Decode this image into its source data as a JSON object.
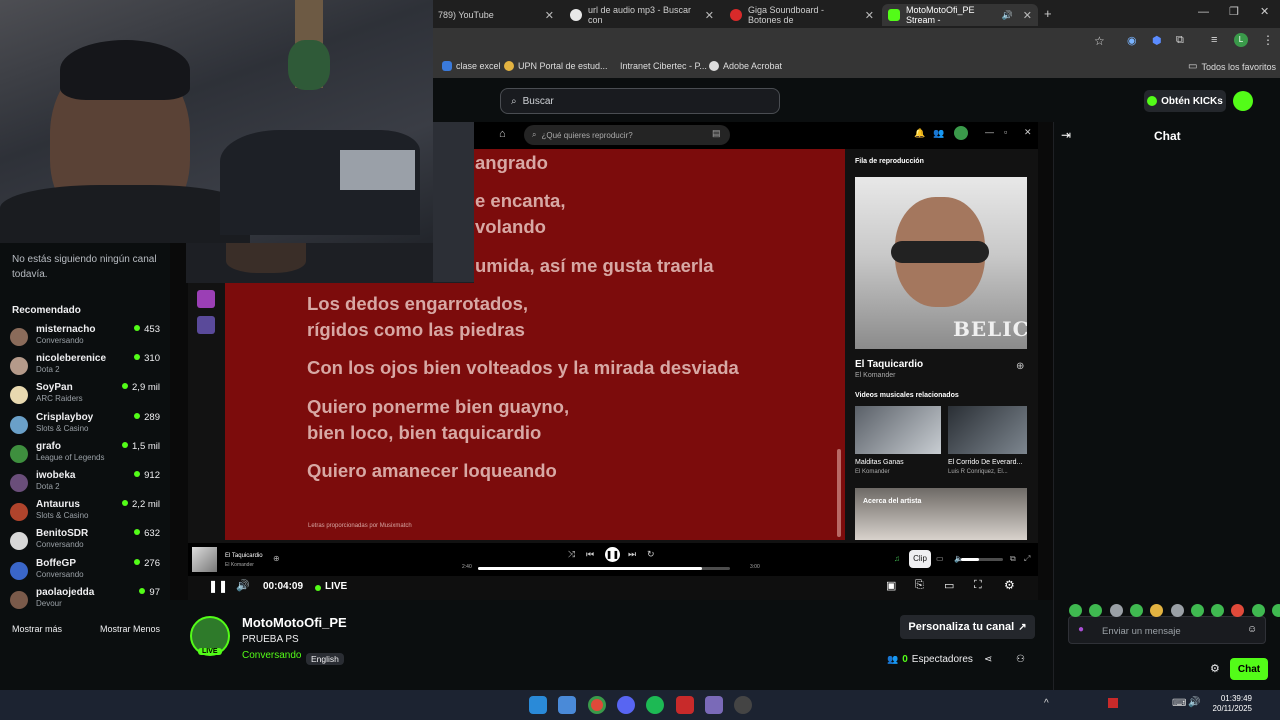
{
  "browser": {
    "tabs": [
      {
        "label": "789) YouTube"
      },
      {
        "label": "url de audio mp3 - Buscar con"
      },
      {
        "label": "Giga Soundboard - Botones de"
      },
      {
        "label": "MotoMotoOfi_PE Stream -"
      }
    ],
    "bookmarks": [
      "clase excel",
      "UPN Portal de estud...",
      "Intranet Cibertec - P...",
      "Adobe Acrobat"
    ],
    "all_bookmarks": "Todos los favoritos",
    "profile_letter": "L"
  },
  "kick": {
    "search_placeholder": "Buscar",
    "get_kicks": "Obtén KICKs"
  },
  "sidebar": {
    "following_empty": "No estás siguiendo ningún canal todavía.",
    "recommended_title": "Recomendado",
    "items": [
      {
        "name": "misternacho",
        "game": "Conversando",
        "count": "453",
        "color": "#8a6b5a"
      },
      {
        "name": "nicoleberenice",
        "game": "Dota 2",
        "count": "310",
        "color": "#b59a8a"
      },
      {
        "name": "SoyPan",
        "game": "ARC Raiders",
        "count": "2,9 mil",
        "color": "#e8d9b0"
      },
      {
        "name": "Crisplayboy",
        "game": "Slots & Casino",
        "count": "289",
        "color": "#6aa0c8"
      },
      {
        "name": "grafo",
        "game": "League of Legends",
        "count": "1,5 mil",
        "color": "#3e8f3e"
      },
      {
        "name": "iwobeka",
        "game": "Dota 2",
        "count": "912",
        "color": "#6a4e7a"
      },
      {
        "name": "Antaurus",
        "game": "Slots & Casino",
        "count": "2,2 mil",
        "color": "#b0442c"
      },
      {
        "name": "BenitoSDR",
        "game": "Conversando",
        "count": "632",
        "color": "#d8d8d8"
      },
      {
        "name": "BoffeGP",
        "game": "Conversando",
        "count": "276",
        "color": "#3a66c8"
      },
      {
        "name": "paolaojedda",
        "game": "Devour",
        "count": "97",
        "color": "#7a5a4a"
      }
    ],
    "show_more": "Mostrar más",
    "show_less": "Mostrar Menos"
  },
  "spotify": {
    "search_placeholder": "¿Qué quieres reproducir?",
    "lyrics": [
      "angrado",
      "e encanta,",
      "volando",
      "umida, así me gusta traerla",
      "Los dedos engarrotados,",
      "rígidos como las piedras",
      "Con los ojos bien volteados y la mirada desviada",
      "Quiero ponerme bien guayno,",
      "bien loco, bien taquicardio",
      "Quiero amanecer loqueando"
    ],
    "lyrics_credit": "Letras proporcionadas por Musixmatch",
    "queue_title": "Fila de reproducción",
    "track_title": "El Taquicardio",
    "track_artist": "El Komander",
    "related_title": "Videos musicales relacionados",
    "related": [
      {
        "title": "Malditas Ganas",
        "artist": "El Komander"
      },
      {
        "title": "El Corrido De Everard...",
        "artist": "Luis R Conriquez, El..."
      }
    ],
    "about_artist": "Acerca del artista",
    "elapsed": "2:40",
    "duration": "3:00",
    "progress": 0.89,
    "album_text": "BELICO"
  },
  "stream": {
    "uptime": "00:04:09",
    "live_label": "LIVE",
    "clip_tooltip": "Clip"
  },
  "channel": {
    "name": "MotoMotoOfi_PE",
    "title": "PRUEBA PS",
    "category": "Conversando",
    "language": "English",
    "live_badge": "LIVE",
    "customize_button": "Personaliza tu canal",
    "viewers_count": "0",
    "viewers_label": "Espectadores"
  },
  "chat": {
    "title": "Chat",
    "input_placeholder": "Enviar un mensaje",
    "send_button": "Chat"
  },
  "taskbar": {
    "time": "01:39:49",
    "date": "20/11/2025"
  }
}
